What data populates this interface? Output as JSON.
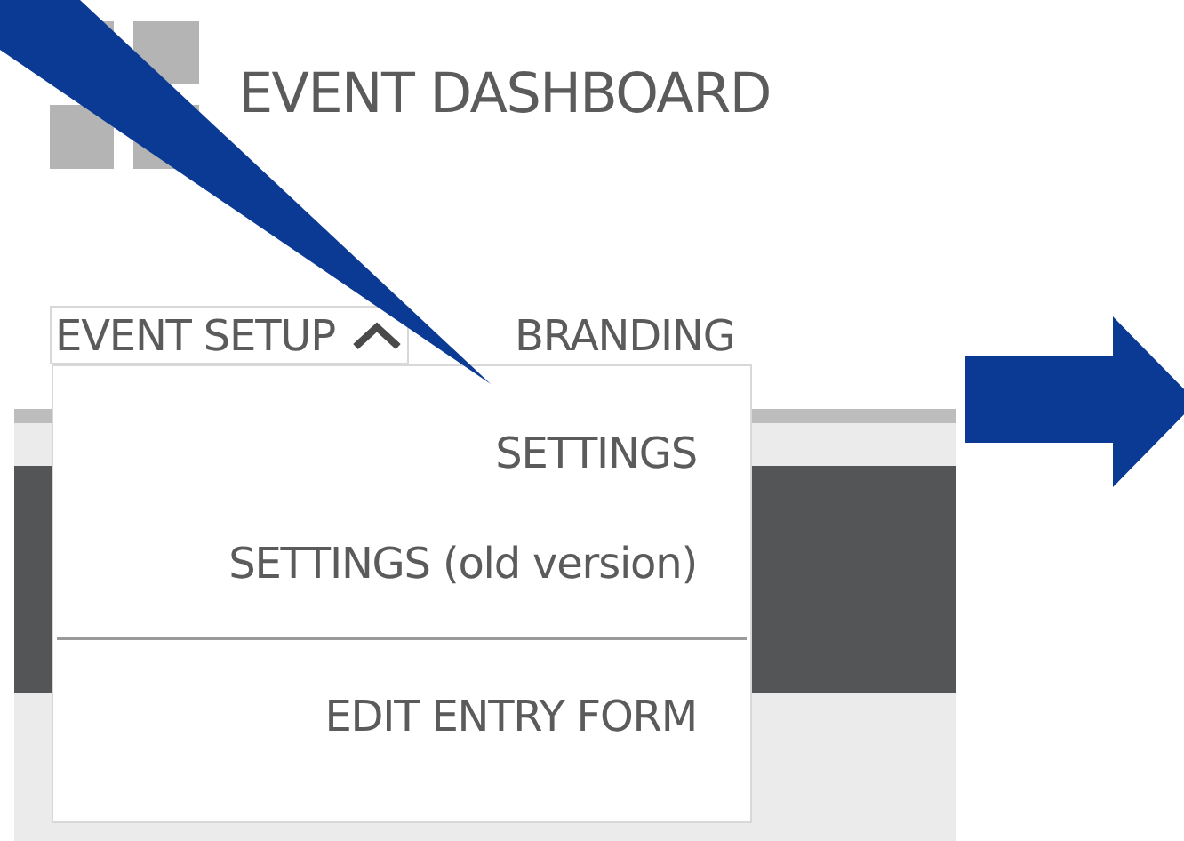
{
  "header": {
    "title": "EVENT DASHBOARD"
  },
  "tabs": [
    {
      "label": "EVENT SETUP",
      "expanded": true
    },
    {
      "label": "BRANDING",
      "expanded": false
    }
  ],
  "dropdown": {
    "items": [
      {
        "kind": "item",
        "label": "SETTINGS"
      },
      {
        "kind": "item",
        "label": "SETTINGS (old version)"
      },
      {
        "kind": "divider"
      },
      {
        "kind": "item",
        "label": "EDIT ENTRY FORM"
      }
    ]
  }
}
